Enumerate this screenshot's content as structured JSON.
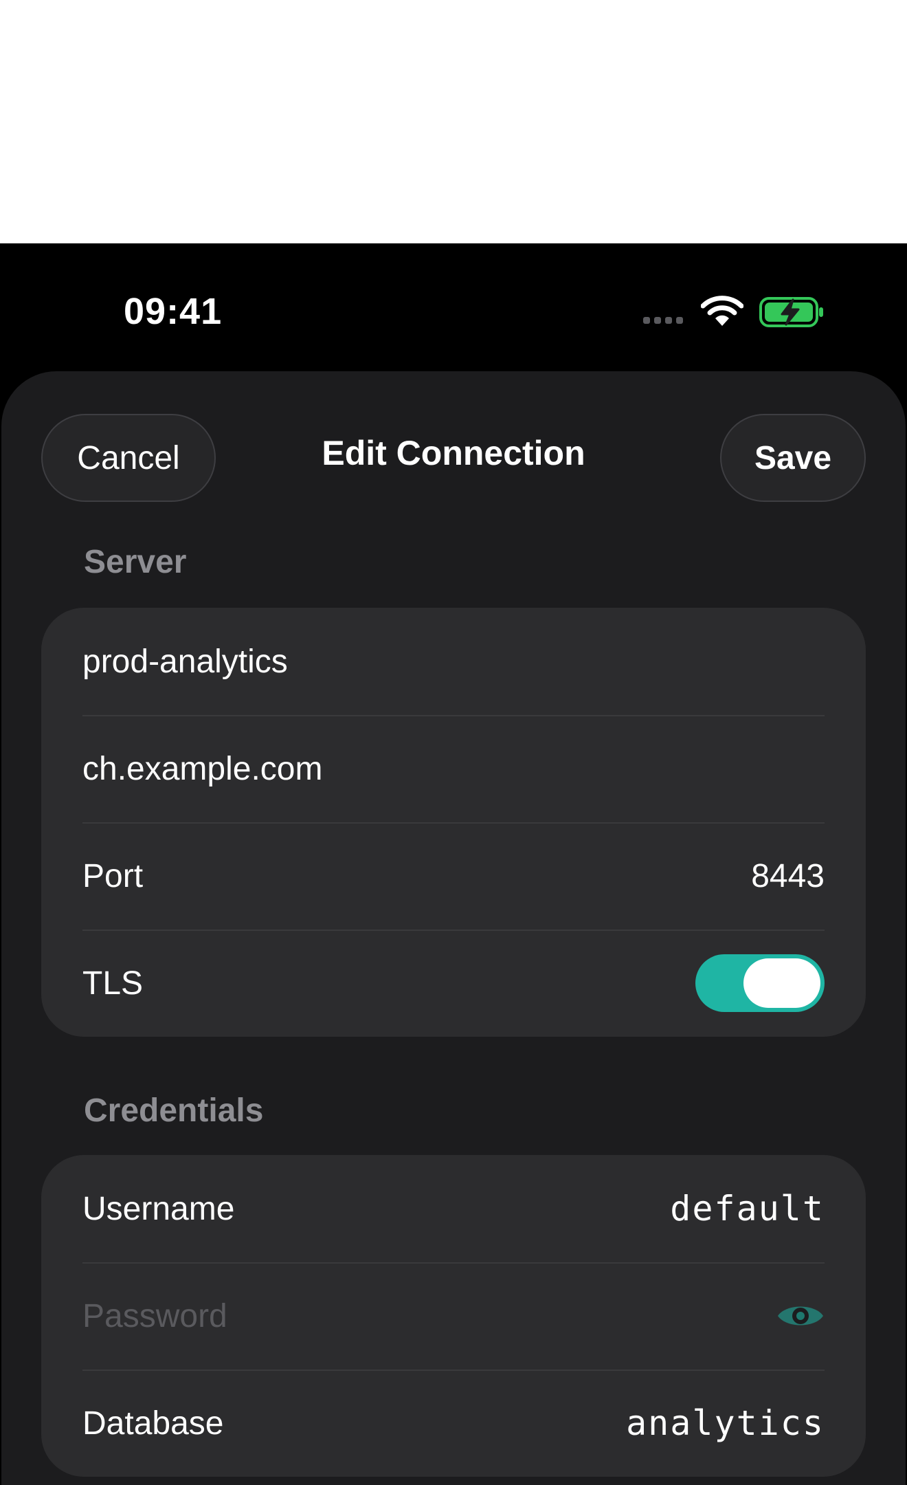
{
  "status_bar": {
    "time": "09:41"
  },
  "nav": {
    "cancel_label": "Cancel",
    "title": "Edit Connection",
    "save_label": "Save"
  },
  "server": {
    "section_label": "Server",
    "name_value": "prod-analytics",
    "host_value": "ch.example.com",
    "port_label": "Port",
    "port_value": "8443",
    "tls_label": "TLS",
    "tls_enabled": true
  },
  "credentials": {
    "section_label": "Credentials",
    "username_label": "Username",
    "username_value": "default",
    "password_placeholder": "Password",
    "database_label": "Database",
    "database_value": "analytics"
  },
  "colors": {
    "accent": "#1fb5a4",
    "sheet_background": "#1c1c1e",
    "group_background": "#2c2c2e",
    "battery_charging": "#34c759"
  },
  "icons": [
    "wifi-icon",
    "battery-charging-icon",
    "eye-icon"
  ]
}
